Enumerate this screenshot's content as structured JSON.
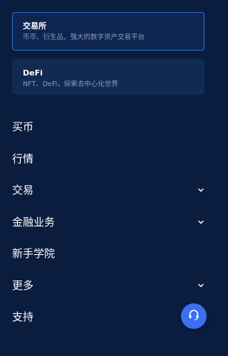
{
  "cards": [
    {
      "title": "交易所",
      "subtitle": "币币、衍生品，强大的数字资产交易平台"
    },
    {
      "title": "DeFi",
      "subtitle": "NFT、DeFi，探索去中心化世界"
    }
  ],
  "nav": {
    "items": [
      {
        "label": "买币"
      },
      {
        "label": "行情"
      },
      {
        "label": "交易"
      },
      {
        "label": "金融业务"
      },
      {
        "label": "新手学院"
      },
      {
        "label": "更多"
      },
      {
        "label": "支持"
      }
    ]
  },
  "colors": {
    "background": "#0a1d3e",
    "accent": "#2f6fd6",
    "support_button": "#3d6ef0"
  },
  "icons": {
    "chevron": "chevron-down-icon",
    "support": "headset-icon"
  }
}
